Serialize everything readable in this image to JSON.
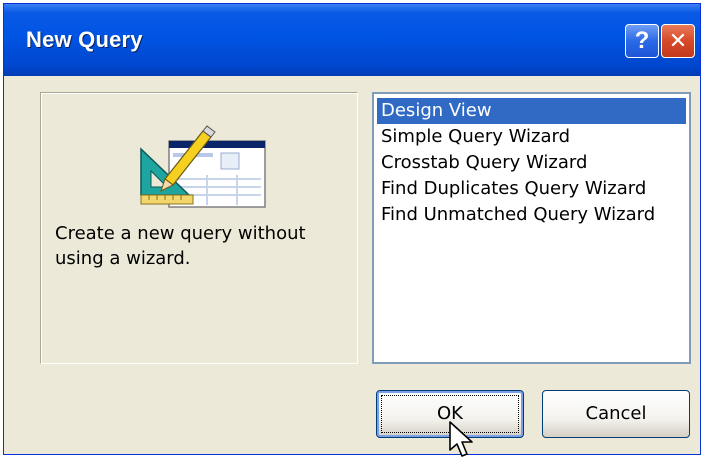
{
  "window": {
    "title": "New Query",
    "help_label": "?",
    "close_label": "✕"
  },
  "description": {
    "text": "Create a new query without using a wizard.",
    "icon": "query-design-icon"
  },
  "query_types": {
    "selected_index": 0,
    "items": [
      {
        "label": "Design View"
      },
      {
        "label": "Simple Query Wizard"
      },
      {
        "label": "Crosstab Query Wizard"
      },
      {
        "label": "Find Duplicates Query Wizard"
      },
      {
        "label": "Find Unmatched Query Wizard"
      }
    ]
  },
  "buttons": {
    "ok_label": "OK",
    "cancel_label": "Cancel"
  },
  "colors": {
    "title_bar": "#0054e3",
    "selection": "#316ac5",
    "dialog_bg": "#ece9d8"
  }
}
